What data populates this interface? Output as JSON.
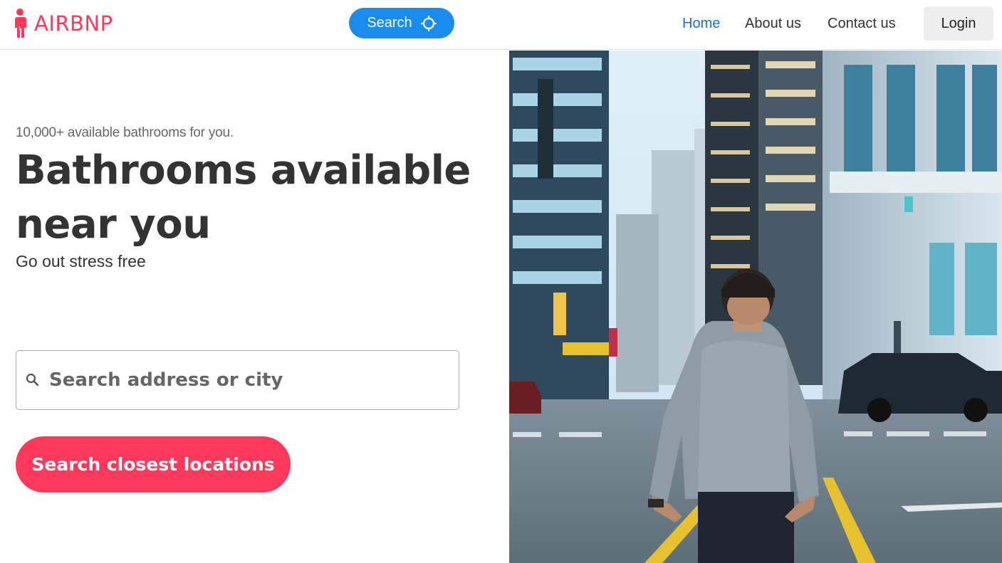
{
  "header": {
    "brand": "AIRBNP",
    "search_button_label": "Search",
    "nav": {
      "home": "Home",
      "about": "About us",
      "contact": "Contact us"
    },
    "login_label": "Login"
  },
  "hero": {
    "tagline": "10,000+ available bathrooms for you.",
    "headline_line1": "Bathrooms available",
    "headline_line2": "near you",
    "subhead": "Go out stress free",
    "search_placeholder": "Search address or city",
    "cta_label": "Search closest locations"
  },
  "icons": {
    "logo": "person-standing-icon",
    "locate": "crosshair-icon",
    "search": "magnifier-icon"
  },
  "colors": {
    "brand": "#ff385c",
    "primary_blue": "#1a8cee",
    "nav_active": "#1f6fc4"
  }
}
